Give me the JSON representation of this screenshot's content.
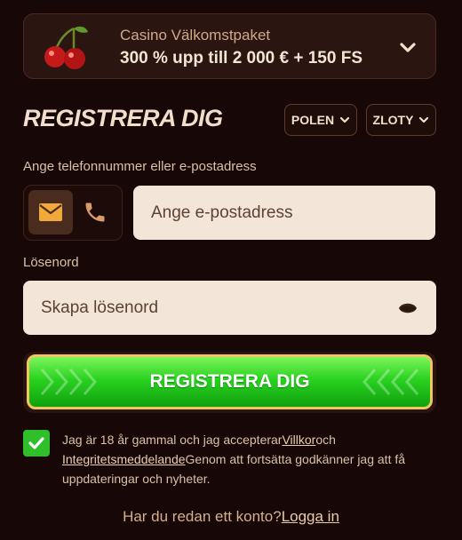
{
  "promo": {
    "title": "Casino Välkomstpaket",
    "offer": "300 % upp till 2 000 € + 150 FS",
    "icon": "cherries-icon"
  },
  "form": {
    "heading": "REGISTRERA DIG",
    "country": "POLEN",
    "currency": "ZLOTY",
    "contact_label": "Ange telefonnummer eller e-postadress",
    "email_placeholder": "Ange e-postadress",
    "password_label": "Lösenord",
    "password_placeholder": "Skapa lösenord",
    "submit_label": "REGISTRERA DIG"
  },
  "terms": {
    "checked": true,
    "part1": "Jag är 18 år gammal och jag accepterar",
    "terms_link": "Villkor",
    "and": "och",
    "privacy_link": "Integritetsmeddelande",
    "part2": "Genom att fortsätta godkänner jag att få uppdateringar och nyheter."
  },
  "footer": {
    "question": "Har du redan ett konto?",
    "login_link": "Logga in"
  },
  "colors": {
    "background": "#170807",
    "accent_green": "#29d21f",
    "button_border": "#f1c65c",
    "input_bg": "#f3e6d8"
  }
}
